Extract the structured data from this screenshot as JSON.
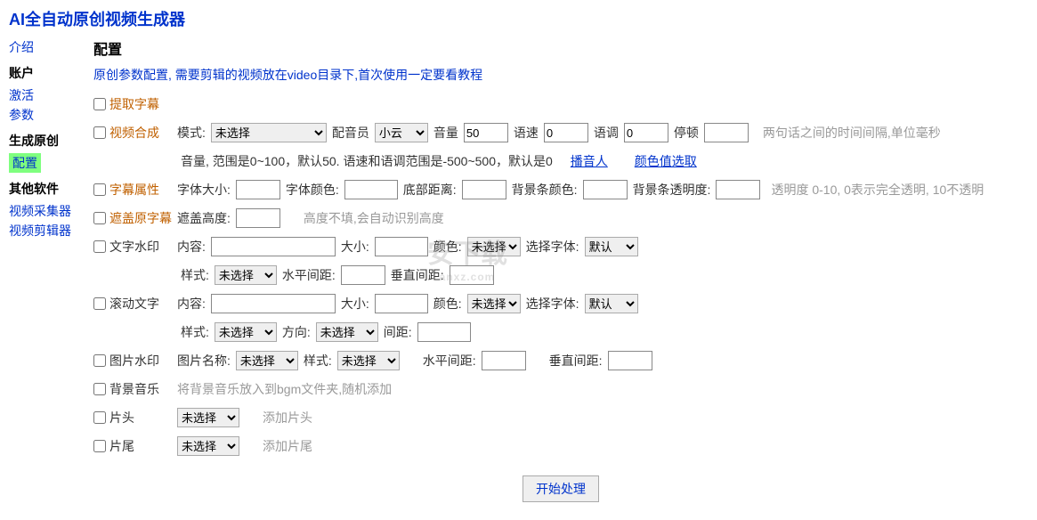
{
  "app_title": "AI全自动原创视频生成器",
  "sidebar": {
    "intro": "介绍",
    "account_heading": "账户",
    "account": {
      "activate": "激活",
      "params": "参数"
    },
    "generate_heading": "生成原创",
    "generate": {
      "config": "配置"
    },
    "other_heading": "其他软件",
    "other": {
      "collector": "视频采集器",
      "editor": "视频剪辑器"
    }
  },
  "page": {
    "title": "配置",
    "subtitle": "原创参数配置, 需要剪辑的视频放在video目录下,首次使用一定要看教程"
  },
  "extract_subtitle": {
    "label": "提取字幕"
  },
  "video_synth": {
    "label": "视频合成",
    "mode_label": "模式:",
    "mode_value": "未选择",
    "voicer_label": "配音员",
    "voicer_value": "小云",
    "volume_label": "音量",
    "volume_value": "50",
    "rate_label": "语速",
    "rate_value": "0",
    "pitch_label": "语调",
    "pitch_value": "0",
    "pause_label": "停顿",
    "pause_value": "",
    "pause_hint": "两句话之间的时间间隔,单位毫秒",
    "hint2": "音量, 范围是0~100，默认50. 语速和语调范围是-500~500，默认是0",
    "link_voicer": "播音人",
    "link_color": "颜色值选取"
  },
  "subtitle_attr": {
    "label": "字幕属性",
    "font_size_label": "字体大小:",
    "font_color_label": "字体颜色:",
    "bottom_dist_label": "底部距离:",
    "bg_color_label": "背景条颜色:",
    "bg_alpha_label": "背景条透明度:",
    "alpha_hint": "透明度 0-10, 0表示完全透明, 10不透明"
  },
  "cover_sub": {
    "label": "遮盖原字幕",
    "height_label": "遮盖高度:",
    "hint": "高度不填,会自动识别高度"
  },
  "text_wm": {
    "label": "文字水印",
    "content_label": "内容:",
    "size_label": "大小:",
    "color_label": "颜色:",
    "color_value": "未选择",
    "font_label": "选择字体:",
    "font_value": "默认",
    "style_label": "样式:",
    "style_value": "未选择",
    "hspace_label": "水平间距:",
    "vspace_label": "垂直间距:"
  },
  "scroll_text": {
    "label": "滚动文字",
    "content_label": "内容:",
    "size_label": "大小:",
    "color_label": "颜色:",
    "color_value": "未选择",
    "font_label": "选择字体:",
    "font_value": "默认",
    "style_label": "样式:",
    "style_value": "未选择",
    "dir_label": "方向:",
    "dir_value": "未选择",
    "gap_label": "间距:"
  },
  "image_wm": {
    "label": "图片水印",
    "name_label": "图片名称:",
    "name_value": "未选择",
    "style_label": "样式:",
    "style_value": "未选择",
    "hspace_label": "水平间距:",
    "vspace_label": "垂直间距:"
  },
  "bgm": {
    "label": "背景音乐",
    "hint": "将背景音乐放入到bgm文件夹,随机添加"
  },
  "opening": {
    "label": "片头",
    "value": "未选择",
    "hint": "添加片头"
  },
  "ending": {
    "label": "片尾",
    "value": "未选择",
    "hint": "添加片尾"
  },
  "submit": "开始处理",
  "watermark_text": "安下载",
  "watermark_sub": "anxz.com"
}
